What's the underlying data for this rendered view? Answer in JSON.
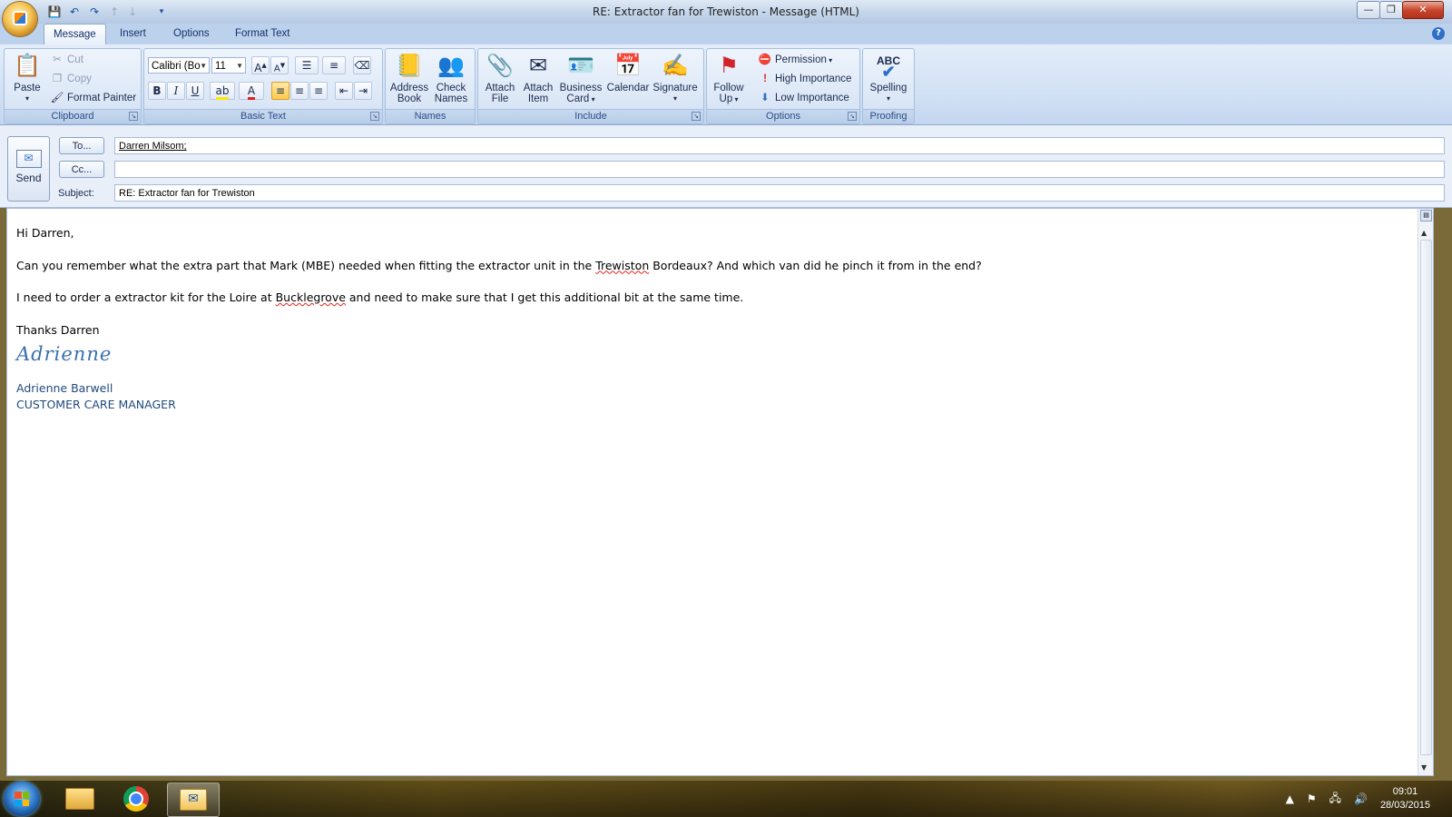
{
  "window": {
    "title": "RE: Extractor fan for Trewiston - Message (HTML)",
    "controls": {
      "minimize": "—",
      "restore": "❐",
      "close": "✕"
    }
  },
  "tabs": [
    {
      "label": "Message",
      "active": true
    },
    {
      "label": "Insert",
      "active": false
    },
    {
      "label": "Options",
      "active": false
    },
    {
      "label": "Format Text",
      "active": false
    }
  ],
  "ribbon": {
    "clipboard": {
      "label": "Clipboard",
      "paste": "Paste",
      "cut": "Cut",
      "copy": "Copy",
      "format_painter": "Format Painter"
    },
    "basic_text": {
      "label": "Basic Text",
      "font": "Calibri (Bo",
      "size": "11"
    },
    "names": {
      "label": "Names",
      "address_book_1": "Address",
      "address_book_2": "Book",
      "check_names_1": "Check",
      "check_names_2": "Names"
    },
    "include": {
      "label": "Include",
      "attach_file_1": "Attach",
      "attach_file_2": "File",
      "attach_item_1": "Attach",
      "attach_item_2": "Item",
      "business_card_1": "Business",
      "business_card_2": "Card",
      "calendar": "Calendar",
      "signature": "Signature"
    },
    "options": {
      "label": "Options",
      "follow_up_1": "Follow",
      "follow_up_2": "Up",
      "permission": "Permission",
      "high_importance": "High Importance",
      "low_importance": "Low Importance"
    },
    "proofing": {
      "label": "Proofing",
      "spelling": "Spelling",
      "abc": "ABC"
    }
  },
  "header": {
    "send": "Send",
    "to_button": "To...",
    "cc_button": "Cc...",
    "subject_label": "Subject:",
    "to_value": "Darren Milsom;",
    "cc_value": "",
    "subject_value": "RE: Extractor fan for Trewiston"
  },
  "body": {
    "greeting": "Hi Darren,",
    "p1_a": "Can you remember what the extra part that Mark (MBE) needed when fitting the extractor unit in the ",
    "p1_b": "Trewiston",
    "p1_c": " Bordeaux?  And which van did he pinch it from in the end?",
    "p2_a": "I need to order a extractor kit for the Loire at ",
    "p2_b": "Bucklegrove",
    "p2_c": " and need to make sure that I get this additional bit at the same time.",
    "closing": "Thanks Darren",
    "signature_script": "Adrienne",
    "signature_name": "Adrienne Barwell",
    "signature_title": "CUSTOMER CARE MANAGER"
  },
  "taskbar": {
    "time": "09:01",
    "date": "28/03/2015"
  },
  "colors": {
    "accent": "#2f6fc7",
    "signature": "#1f497d"
  }
}
